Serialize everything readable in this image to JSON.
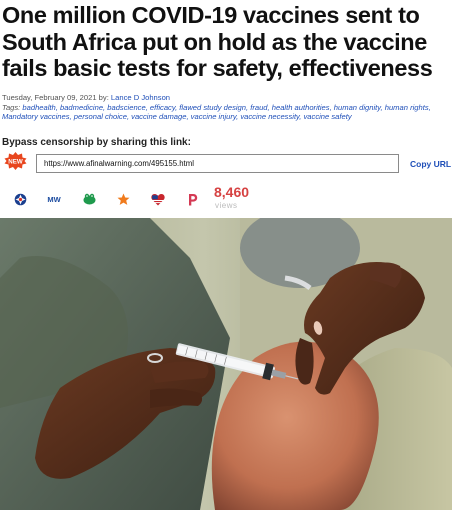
{
  "article": {
    "title": "One million COVID-19 vaccines sent to South Africa put on hold as the vaccine fails basic tests for safety, effectiveness",
    "date": "Tuesday, February 09, 2021",
    "by_label": " by: ",
    "author": "Lance D Johnson",
    "tags_label": "Tags: ",
    "tags": "badhealth, badmedicine, badscience, efficacy, flawed study design, fraud, health authorities, human dignity, human rights, Mandatory vaccines, personal choice, vaccine damage, vaccine injury, vaccine necessity, vaccine safety"
  },
  "share": {
    "bypass_label": "Bypass censorship by sharing this link:",
    "new_badge": "NEW",
    "url": "https://www.afinalwarning.com/495155.html",
    "copy_label": "Copy URL",
    "icons": [
      "brighteon-icon",
      "mewe-icon",
      "gab-icon",
      "social-star-icon",
      "flag-heart-icon",
      "parler-icon"
    ]
  },
  "stats": {
    "views_count": "8,460",
    "views_label": "views"
  },
  "colors": {
    "link": "#1f4fb8",
    "views": "#d64242",
    "badge": "#e8461e"
  }
}
